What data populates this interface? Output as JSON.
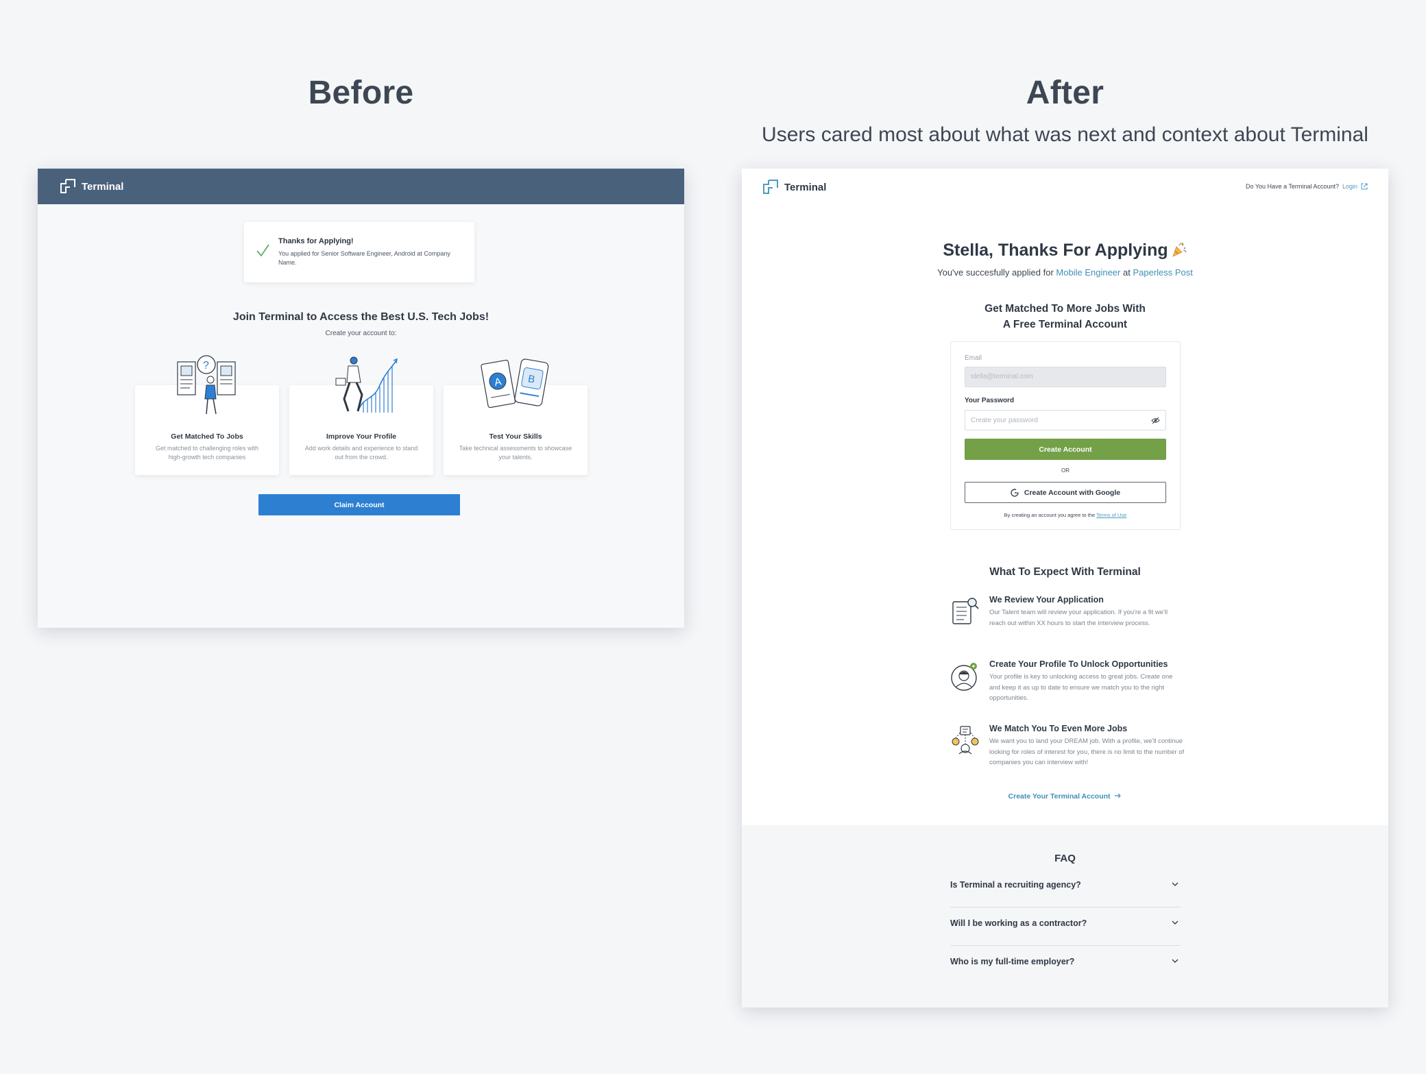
{
  "headings": {
    "before": "Before",
    "after": "After",
    "after_sub": "Users cared most about what was next and context about Terminal"
  },
  "before": {
    "brand": "Terminal",
    "toast": {
      "title": "Thanks for Applying!",
      "body": "You applied for Senior Software Engineer, Android at Company Name."
    },
    "join_title": "Join Terminal to Access the Best U.S. Tech Jobs!",
    "create_sub": "Create your account to:",
    "cards": [
      {
        "title": "Get Matched To Jobs",
        "desc": "Get matched to challenging roles with high-growth tech companies"
      },
      {
        "title": "Improve Your Profile",
        "desc": "Add work details and experience to stand out from the crowd."
      },
      {
        "title": "Test Your Skills",
        "desc": "Take technical assessments to showcase your talents."
      }
    ],
    "claim_button": "Claim Account",
    "colors": {
      "topbar": "#4a617c",
      "claim": "#2d7fd2"
    }
  },
  "after": {
    "brand": "Terminal",
    "have_account": "Do You Have a Terminal Account?",
    "login": "Login",
    "thanks": "Stella, Thanks For Applying",
    "applied": {
      "prefix": "You've succesfully applied for",
      "role": "Mobile Engineer",
      "at": "at",
      "company": "Paperless Post"
    },
    "matched_line1": "Get Matched To More Jobs With",
    "matched_line2": "A Free Terminal Account",
    "form": {
      "email_label": "Email",
      "email_value": "stella@terminal.com",
      "password_label": "Your Password",
      "password_placeholder": "Create your password",
      "create_button": "Create Account",
      "or": "OR",
      "google_button": "Create Account with Google",
      "terms_prefix": "By creating an account you agree to the",
      "terms_link": "Terms of Use"
    },
    "expect_title": "What To Expect With Terminal",
    "steps": [
      {
        "title": "We Review Your Application",
        "desc": "Our Talent team will review your application. If you're a fit we'll reach out within XX hours to start the interview process.",
        "icon": "document-search-icon"
      },
      {
        "title": "Create Your Profile To Unlock Opportunities",
        "desc": "Your profile is key to unlocking access to great jobs. Create one and keep it as up to date to ensure we match you to the right opportunities.",
        "icon": "profile-avatar-icon"
      },
      {
        "title": "We Match You To Even More Jobs",
        "desc": "We want you to land your DREAM job. With a profile, we'll continue looking for roles of interest for you, there is no limit to the number of companies you can interview with!",
        "icon": "match-people-icon"
      }
    ],
    "create_link": "Create Your Terminal Account",
    "faq_title": "FAQ",
    "faq": [
      "Is Terminal a recruiting agency?",
      "Will I be working as a contractor?",
      "Who is my full-time employer?"
    ],
    "colors": {
      "create": "#74a048",
      "link": "#3f8fb5"
    }
  }
}
